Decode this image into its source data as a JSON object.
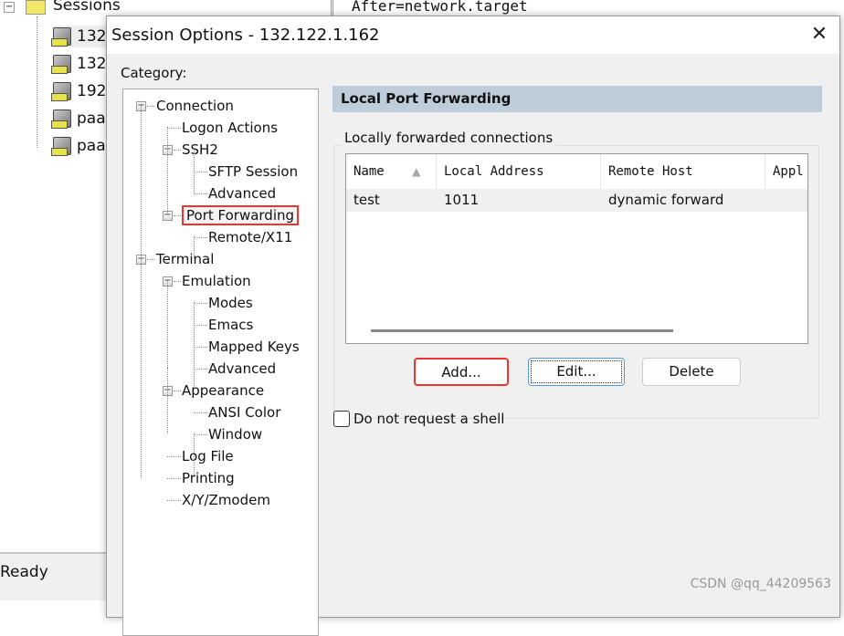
{
  "background": {
    "sessions_root": "Sessions",
    "sessions": [
      "132",
      "132",
      "192",
      "paa",
      "paa"
    ],
    "status": "Ready",
    "terminal_text": "After=network.target"
  },
  "dialog": {
    "title": "Session Options - 132.122.1.162",
    "category_label": "Category:",
    "tree": [
      {
        "label": "Connection",
        "level": 0,
        "expanded": true
      },
      {
        "label": "Logon Actions",
        "level": 1
      },
      {
        "label": "SSH2",
        "level": 1,
        "expanded": true
      },
      {
        "label": "SFTP Session",
        "level": 2
      },
      {
        "label": "Advanced",
        "level": 2
      },
      {
        "label": "Port Forwarding",
        "level": 1,
        "expanded": true,
        "selected": true
      },
      {
        "label": "Remote/X11",
        "level": 2
      },
      {
        "label": "Terminal",
        "level": 0,
        "expanded": true
      },
      {
        "label": "Emulation",
        "level": 1,
        "expanded": true
      },
      {
        "label": "Modes",
        "level": 2
      },
      {
        "label": "Emacs",
        "level": 2
      },
      {
        "label": "Mapped Keys",
        "level": 2
      },
      {
        "label": "Advanced",
        "level": 2
      },
      {
        "label": "Appearance",
        "level": 1,
        "expanded": true
      },
      {
        "label": "ANSI Color",
        "level": 2
      },
      {
        "label": "Window",
        "level": 2
      },
      {
        "label": "Log File",
        "level": 1
      },
      {
        "label": "Printing",
        "level": 1
      },
      {
        "label": "X/Y/Zmodem",
        "level": 1
      }
    ],
    "panel_title": "Local Port Forwarding",
    "group_label": "Locally forwarded connections",
    "columns": [
      "Name",
      "Local Address",
      "Remote Host",
      "Appl"
    ],
    "rows": [
      [
        "test",
        "1011",
        "dynamic forward",
        ""
      ]
    ],
    "buttons": {
      "add": "Add...",
      "edit": "Edit...",
      "delete": "Delete"
    },
    "checkbox": {
      "label": "Do not request a shell",
      "checked": false
    },
    "header_color": "#bfcddb",
    "highlight_color": "#e33333"
  },
  "watermark": "CSDN @qq_44209563"
}
